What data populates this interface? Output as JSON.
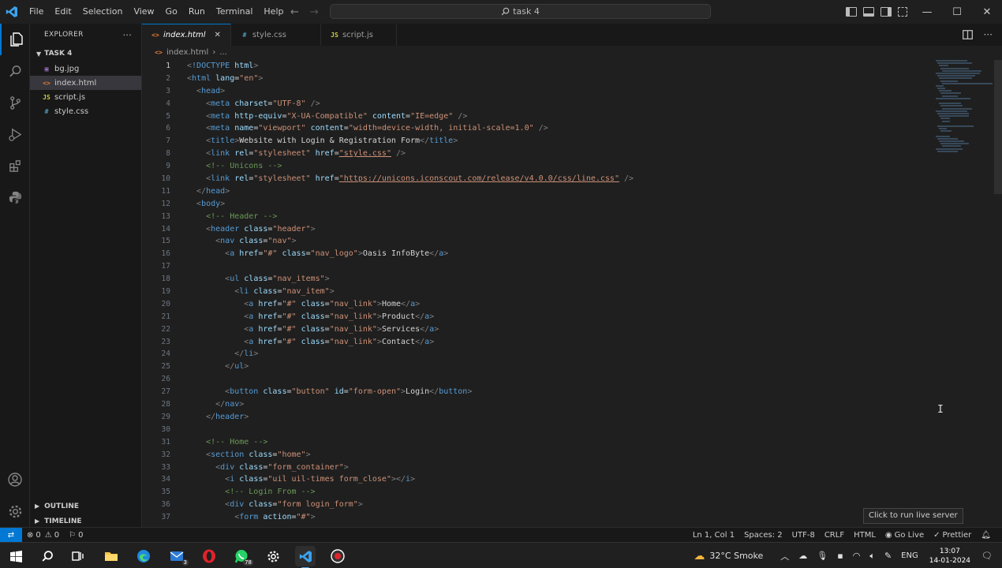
{
  "menubar": {
    "items": [
      "File",
      "Edit",
      "Selection",
      "View",
      "Go",
      "Run",
      "Terminal",
      "Help"
    ],
    "search_text": "task 4"
  },
  "sidebar": {
    "title": "EXPLORER",
    "more": "···",
    "folder": "TASK 4",
    "files": [
      {
        "name": "bg.jpg",
        "badge": "▣",
        "color": "#a074c4"
      },
      {
        "name": "index.html",
        "badge": "<>",
        "color": "#e37933"
      },
      {
        "name": "script.js",
        "badge": "JS",
        "color": "#cbcb41"
      },
      {
        "name": "style.css",
        "badge": "#",
        "color": "#519aba"
      }
    ],
    "outline": "OUTLINE",
    "timeline": "TIMELINE"
  },
  "tabs": [
    {
      "label": "index.html",
      "badge": "<>",
      "color": "#e37933"
    },
    {
      "label": "style.css",
      "badge": "#",
      "color": "#519aba"
    },
    {
      "label": "script.js",
      "badge": "JS",
      "color": "#cbcb41"
    }
  ],
  "breadcrumb": {
    "file": "index.html",
    "rest": "..."
  },
  "editor": {
    "line_numbers": [
      "1",
      "2",
      "3",
      "4",
      "5",
      "6",
      "7",
      "8",
      "9",
      "10",
      "11",
      "12",
      "13",
      "14",
      "15",
      "16",
      "17",
      "18",
      "19",
      "20",
      "21",
      "22",
      "23",
      "24",
      "25",
      "26",
      "27",
      "28",
      "29",
      "30",
      "31",
      "32",
      "33",
      "34",
      "35",
      "36",
      "37"
    ],
    "code": {
      "l1_doctype": "!DOCTYPE",
      "l1_html": "html",
      "l2_tag": "html",
      "l2_attr": "lang",
      "l2_val": "\"en\"",
      "l3_tag": "head",
      "l4_tag": "meta",
      "l4_attr": "charset",
      "l4_val": "\"UTF-8\"",
      "l5_tag": "meta",
      "l5_attr1": "http-equiv",
      "l5_val1": "\"X-UA-Compatible\"",
      "l5_attr2": "content",
      "l5_val2": "\"IE=edge\"",
      "l6_tag": "meta",
      "l6_attr1": "name",
      "l6_val1": "\"viewport\"",
      "l6_attr2": "content",
      "l6_val2": "\"width=device-width, initial-scale=1.0\"",
      "l7_tag": "title",
      "l7_text": "Website with Login & Registration Form",
      "l8_tag": "link",
      "l8_attr1": "rel",
      "l8_val1": "\"stylesheet\"",
      "l8_attr2": "href",
      "l8_val2": "\"style.css\"",
      "l9_comment": "<!-- Unicons -->",
      "l10_tag": "link",
      "l10_attr1": "rel",
      "l10_val1": "\"stylesheet\"",
      "l10_attr2": "href",
      "l10_url": "\"https://unicons.iconscout.com/release/v4.0.0/css/line.css\"",
      "l11_tag": "head",
      "l12_tag": "body",
      "l13_comment": "<!-- Header -->",
      "l14_tag": "header",
      "l14_attr": "class",
      "l14_val": "\"header\"",
      "l15_tag": "nav",
      "l15_attr": "class",
      "l15_val": "\"nav\"",
      "l16_tag": "a",
      "l16_attr1": "href",
      "l16_val1": "\"#\"",
      "l16_attr2": "class",
      "l16_val2": "\"nav_logo\"",
      "l16_text": "Oasis InfoByte",
      "l18_tag": "ul",
      "l18_attr": "class",
      "l18_val": "\"nav_items\"",
      "l19_tag": "li",
      "l19_attr": "class",
      "l19_val": "\"nav_item\"",
      "link_tag": "a",
      "link_attr1": "href",
      "link_val1": "\"#\"",
      "link_attr2": "class",
      "link_val2": "\"nav_link\"",
      "l20_text": "Home",
      "l21_text": "Product",
      "l22_text": "Services",
      "l23_text": "Contact",
      "l24_tag": "li",
      "l25_tag": "ul",
      "l27_tag": "button",
      "l27_attr1": "class",
      "l27_val1": "\"button\"",
      "l27_attr2": "id",
      "l27_val2": "\"form-open\"",
      "l27_text": "Login",
      "l28_tag": "nav",
      "l29_tag": "header",
      "l31_comment": "<!-- Home -->",
      "l32_tag": "section",
      "l32_attr": "class",
      "l32_val": "\"home\"",
      "l33_tag": "div",
      "l33_attr": "class",
      "l33_val": "\"form_container\"",
      "l34_tag": "i",
      "l34_attr": "class",
      "l34_val": "\"uil uil-times form_close\"",
      "l35_comment": "<!-- Login From -->",
      "l36_tag": "div",
      "l36_attr": "class",
      "l36_val": "\"form login_form\"",
      "l37_tag": "form",
      "l37_attr": "action",
      "l37_val": "\"#\""
    }
  },
  "tooltip": "Click to run live server",
  "statusbar": {
    "errors": "0",
    "warnings": "0",
    "ports": "0",
    "position": "Ln 1, Col 1",
    "spaces": "Spaces: 2",
    "encoding": "UTF-8",
    "eol": "CRLF",
    "language": "HTML",
    "golive": "Go Live",
    "prettier": "Prettier"
  },
  "taskbar": {
    "mail_badge": "3",
    "whatsapp_badge": "78",
    "weather": "32°C  Smoke",
    "lang": "ENG",
    "time": "13:07",
    "date": "14-01-2024"
  },
  "colors": {
    "accent": "#0078d4",
    "tag": "#569cd6",
    "attr": "#9cdcfe",
    "string": "#ce9178",
    "comment": "#6a9955"
  }
}
